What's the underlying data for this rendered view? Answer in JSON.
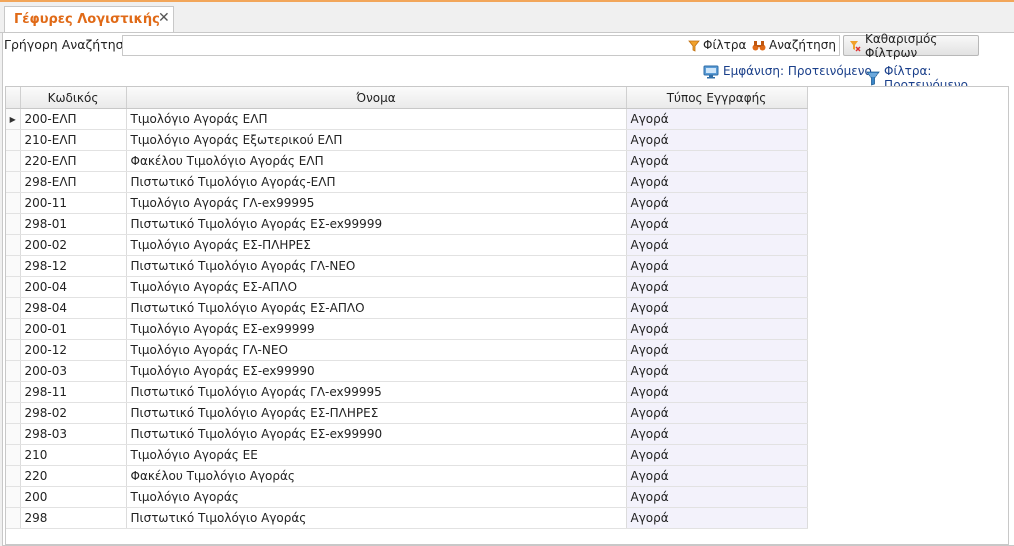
{
  "tab": {
    "title": "Γέφυρες Λογιστικής",
    "close_glyph": "✕"
  },
  "toolbar": {
    "quick_search_label": "Γρήγορη Αναζήτηση",
    "quick_search_value": "",
    "filter_label": "Φίλτρα",
    "search_label": "Αναζήτηση",
    "clear_filters_label": "Καθαρισμός Φίλτρων"
  },
  "view_bar": {
    "view_label": "Εμφάνιση: Προτεινόμενο",
    "filters_label": "Φίλτρα: Προτεινόμενο"
  },
  "grid": {
    "columns": [
      "Κωδικός",
      "Όνομα",
      "Τύπος Εγγραφής"
    ],
    "selected_indicator": "▶",
    "rows": [
      {
        "code": "200-ΕΛΠ",
        "name": "Τιμολόγιο Αγοράς ΕΛΠ",
        "type": "Αγορά"
      },
      {
        "code": "210-ΕΛΠ",
        "name": "Τιμολόγιο Αγοράς Εξωτερικού ΕΛΠ",
        "type": "Αγορά"
      },
      {
        "code": "220-ΕΛΠ",
        "name": "Φακέλου Τιμολόγιο Αγοράς ΕΛΠ",
        "type": "Αγορά"
      },
      {
        "code": "298-ΕΛΠ",
        "name": "Πιστωτικό Τιμολόγιο Αγοράς-ΕΛΠ",
        "type": "Αγορά"
      },
      {
        "code": "200-11",
        "name": "Τιμολόγιο Αγοράς ΓΛ-ex99995",
        "type": "Αγορά"
      },
      {
        "code": "298-01",
        "name": "Πιστωτικό Τιμολόγιο Αγοράς  ΕΣ-ex99999",
        "type": "Αγορά"
      },
      {
        "code": "200-02",
        "name": "Τιμολόγιο Αγοράς  ΕΣ-ΠΛΗΡΕΣ",
        "type": "Αγορά"
      },
      {
        "code": "298-12",
        "name": "Πιστωτικό Τιμολόγιο Αγοράς ΓΛ-ΝΕΟ",
        "type": "Αγορά"
      },
      {
        "code": "200-04",
        "name": "Τιμολόγιο Αγοράς ΕΣ-ΑΠΛΟ",
        "type": "Αγορά"
      },
      {
        "code": "298-04",
        "name": "Πιστωτικό Τιμολόγιο Αγοράς ΕΣ-ΑΠΛΟ",
        "type": "Αγορά"
      },
      {
        "code": "200-01",
        "name": "Τιμολόγιο Αγοράς  ΕΣ-ex99999",
        "type": "Αγορά"
      },
      {
        "code": "200-12",
        "name": "Τιμολόγιο Αγοράς ΓΛ-ΝΕΟ",
        "type": "Αγορά"
      },
      {
        "code": "200-03",
        "name": "Τιμολόγιο Αγοράς  ΕΣ-ex99990",
        "type": "Αγορά"
      },
      {
        "code": "298-11",
        "name": "Πιστωτικό Τιμολόγιο Αγοράς  ΓΛ-ex99995",
        "type": "Αγορά"
      },
      {
        "code": "298-02",
        "name": "Πιστωτικό Τιμολόγιο Αγοράς  ΕΣ-ΠΛΗΡΕΣ",
        "type": "Αγορά"
      },
      {
        "code": "298-03",
        "name": "Πιστωτικό Τιμολόγιο Αγοράς  ΕΣ-ex99990",
        "type": "Αγορά"
      },
      {
        "code": "210",
        "name": "Τιμολόγιο Αγοράς ΕΕ",
        "type": "Αγορά"
      },
      {
        "code": "220",
        "name": "Φακέλου Τιμολόγιο Αγοράς",
        "type": "Αγορά"
      },
      {
        "code": "200",
        "name": "Τιμολόγιο Αγοράς",
        "type": "Αγορά"
      },
      {
        "code": "298",
        "name": "Πιστωτικό Τιμολόγιο Αγοράς",
        "type": "Αγορά"
      }
    ]
  },
  "colors": {
    "accent": "#e06a17",
    "link": "#1a3f8a",
    "type_column_bg": "#f3f2fb"
  },
  "icons": [
    "close-icon",
    "filter-icon",
    "binoculars-icon",
    "clear-filter-icon",
    "monitor-icon",
    "funnel-icon",
    "row-indicator-icon"
  ]
}
